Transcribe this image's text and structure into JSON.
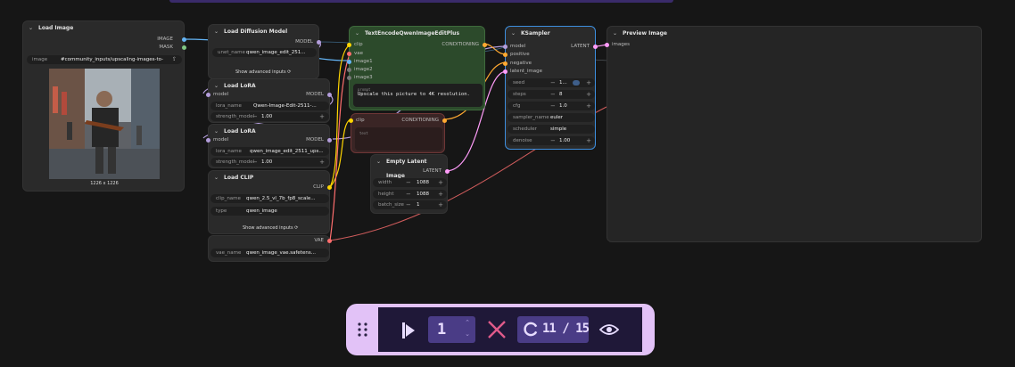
{
  "nodes": {
    "load_image": {
      "title": "Load Image",
      "out_image": "IMAGE",
      "out_mask": "MASK",
      "image_label": "image",
      "image_value": "#community_inputs/upscaling-images-to-ris-...",
      "dimensions": "1226 x 1226"
    },
    "load_diffusion": {
      "title": "Load Diffusion Model",
      "out_model": "MODEL",
      "unet_label": "unet_name",
      "unet_value": "qwen_image_edit_251...",
      "show_advanced": "Show advanced inputs"
    },
    "lora1": {
      "title": "Load LoRA",
      "in_model": "model",
      "out_model": "MODEL",
      "lora_label": "lora_name",
      "lora_value": "Qwen-Image-Edit-2511-...",
      "strength_label": "strength_model",
      "strength_value": "1.00"
    },
    "lora2": {
      "title": "Load LoRA",
      "in_model": "model",
      "out_model": "MODEL",
      "lora_label": "lora_name",
      "lora_value": "qwen_image_edit_2511_ups...",
      "strength_label": "strength_model",
      "strength_value": "1.00"
    },
    "load_clip": {
      "title": "Load CLIP",
      "out_clip": "CLIP",
      "clip_label": "clip_name",
      "clip_value": "qwen_2.5_vl_7b_fp8_scale...",
      "type_label": "type",
      "type_value": "qwen_image",
      "show_advanced": "Show advanced inputs"
    },
    "vae": {
      "out_vae": "VAE",
      "vae_label": "vae_name",
      "vae_value": "qwen_image_vae.safetens..."
    },
    "text_encode": {
      "title": "TextEncodeQwenImageEditPlus",
      "in_clip": "clip",
      "in_vae": "vae",
      "in_image1": "image1",
      "in_image2": "image2",
      "in_image3": "image3",
      "out_conditioning": "CONDITIONING",
      "prompt_label": "prompt",
      "prompt_value": "Upscale this picture to 4K resolution."
    },
    "neg_encode": {
      "in_clip": "clip",
      "out_conditioning": "CONDITIONING",
      "text_label": "text"
    },
    "empty_latent": {
      "title": "Empty Latent Image",
      "out_latent": "LATENT",
      "width_label": "width",
      "width_value": "1088",
      "height_label": "height",
      "height_value": "1088",
      "batch_label": "batch_size",
      "batch_value": "1"
    },
    "ksampler": {
      "title": "KSampler",
      "in_model": "model",
      "in_positive": "positive",
      "in_negative": "negative",
      "in_latent": "latent_image",
      "out_latent": "LATENT",
      "seed_label": "seed",
      "seed_value": "1...",
      "steps_label": "steps",
      "steps_value": "8",
      "cfg_label": "cfg",
      "cfg_value": "1.0",
      "sampler_label": "sampler_name",
      "sampler_value": "euler",
      "scheduler_label": "scheduler",
      "scheduler_value": "simple",
      "denoise_label": "denoise",
      "denoise_value": "1.00"
    },
    "preview": {
      "title": "Preview Image",
      "in_images": "images"
    }
  },
  "toolbar": {
    "batch_count": "1",
    "progress": "11 / 15"
  },
  "colors": {
    "model": "#b39ddb",
    "clip": "#ffd500",
    "vae": "#ff6e6e",
    "conditioning": "#ffa931",
    "latent": "#ff9cf9",
    "image": "#64b5f6",
    "mask": "#81c784",
    "toolbar_bg": "#e2c2f7",
    "toolbar_inner": "#1f1838",
    "toolbar_accent": "#4a3c86"
  },
  "icons": [
    "drag-handle-icon",
    "run-icon",
    "cancel-icon",
    "refresh-icon",
    "eye-icon",
    "upload-icon",
    "collapse-arrow-icon"
  ]
}
